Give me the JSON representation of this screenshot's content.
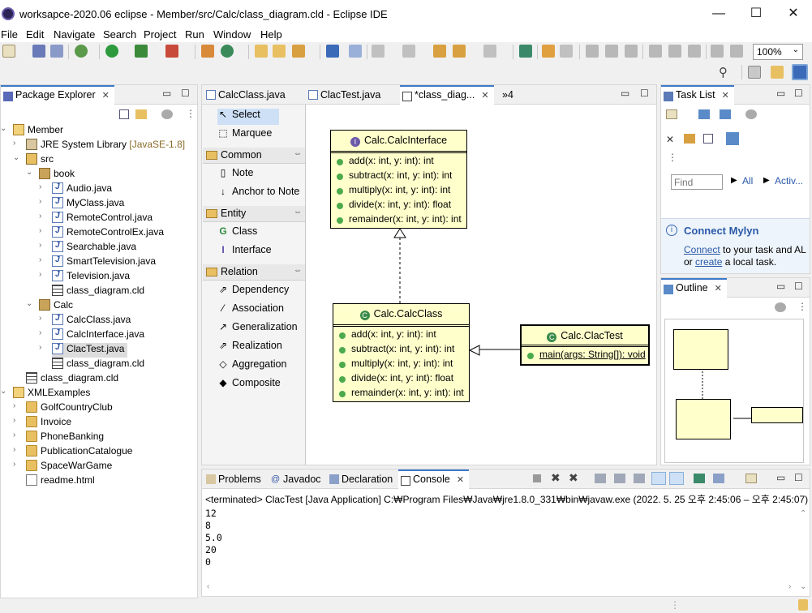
{
  "window": {
    "title": "workspace-2020.06 eclipse - Member/src/Calc/class_diagram.cld - Eclipse IDE",
    "title_text": "worksapce-2020.06 eclipse - Member/src/Calc/class_diagram.cld - Eclipse IDE",
    "minimize": "—",
    "maximize": "☐",
    "close": "✕"
  },
  "menu": [
    "File",
    "Edit",
    "Navigate",
    "Search",
    "Project",
    "Run",
    "Window",
    "Help"
  ],
  "toolbar": {
    "zoom": "100%"
  },
  "package_explorer": {
    "title": "Package Explorer",
    "items": [
      {
        "label": "Member",
        "icon": "project-icon"
      },
      {
        "label": "JRE System Library",
        "suffix": "[JavaSE-1.8]",
        "icon": "library-icon"
      },
      {
        "label": "src",
        "icon": "source-folder-icon"
      },
      {
        "label": "book",
        "icon": "package-icon"
      },
      {
        "label": "Audio.java",
        "icon": "java-file-icon"
      },
      {
        "label": "MyClass.java",
        "icon": "java-file-icon"
      },
      {
        "label": "RemoteControl.java",
        "icon": "java-file-icon"
      },
      {
        "label": "RemoteControlEx.java",
        "icon": "java-file-icon"
      },
      {
        "label": "Searchable.java",
        "icon": "java-file-icon"
      },
      {
        "label": "SmartTelevision.java",
        "icon": "java-file-icon"
      },
      {
        "label": "Television.java",
        "icon": "java-file-icon"
      },
      {
        "label": "class_diagram.cld",
        "icon": "diagram-file-icon"
      },
      {
        "label": "Calc",
        "icon": "package-icon"
      },
      {
        "label": "CalcClass.java",
        "icon": "java-file-icon"
      },
      {
        "label": "CalcInterface.java",
        "icon": "java-file-icon"
      },
      {
        "label": "ClacTest.java",
        "icon": "java-file-icon"
      },
      {
        "label": "class_diagram.cld",
        "icon": "diagram-file-icon"
      },
      {
        "label": "class_diagram.cld",
        "icon": "diagram-file-icon"
      },
      {
        "label": "XMLExamples",
        "icon": "project-icon"
      },
      {
        "label": "GolfCountryClub",
        "icon": "folder-icon"
      },
      {
        "label": "Invoice",
        "icon": "folder-icon"
      },
      {
        "label": "PhoneBanking",
        "icon": "folder-icon"
      },
      {
        "label": "PublicationCatalogue",
        "icon": "folder-icon"
      },
      {
        "label": "SpaceWarGame",
        "icon": "folder-icon"
      },
      {
        "label": "readme.html",
        "icon": "html-file-icon"
      }
    ]
  },
  "editor": {
    "tabs": [
      {
        "label": "CalcClass.java"
      },
      {
        "label": "ClacTest.java"
      },
      {
        "label": "*class_diag..."
      }
    ],
    "overflow": "»4"
  },
  "palette": {
    "tools": [
      "Select",
      "Marquee"
    ],
    "common_title": "Common",
    "common": [
      "Note",
      "Anchor to Note"
    ],
    "entity_title": "Entity",
    "entity": [
      "Class",
      "Interface"
    ],
    "relation_title": "Relation",
    "relation": [
      "Dependency",
      "Association",
      "Generalization",
      "Realization",
      "Aggregation",
      "Composite"
    ]
  },
  "diagram": {
    "interface": {
      "name": "Calc.CalcInterface",
      "methods": [
        "add(x: int, y: int): int",
        "subtract(x: int, y: int): int",
        "multiply(x: int, y: int): int",
        "divide(x: int, y: int): float",
        "remainder(x: int, y: int): int"
      ]
    },
    "calcclass": {
      "name": "Calc.CalcClass",
      "methods": [
        "add(x: int, y: int): int",
        "subtract(x: int, y: int): int",
        "multiply(x: int, y: int): int",
        "divide(x: int, y: int): float",
        "remainder(x: int, y: int): int"
      ]
    },
    "clactest": {
      "name": "Calc.ClacTest",
      "methods": [
        "main(args: String[]): void"
      ]
    }
  },
  "tasklist": {
    "title": "Task List",
    "find_placeholder": "Find",
    "all": "All",
    "activate": "Activ...",
    "mylyn_title": "Connect Mylyn",
    "mylyn_connect": "Connect",
    "mylyn_text1": " to your task and AL",
    "mylyn_or": "or ",
    "mylyn_create": "create",
    "mylyn_text2": " a local task."
  },
  "outline": {
    "title": "Outline"
  },
  "bottom": {
    "tabs": [
      "Problems",
      "Javadoc",
      "Declaration",
      "Console"
    ],
    "status": "<terminated> ClacTest [Java Application] C:₩Program Files₩Java₩jre1.8.0_331₩bin₩javaw.exe  (2022. 5. 25 오후 2:45:06 – 오후 2:45:07)",
    "output": [
      "12",
      "8",
      "5.0",
      "20",
      "0"
    ]
  }
}
